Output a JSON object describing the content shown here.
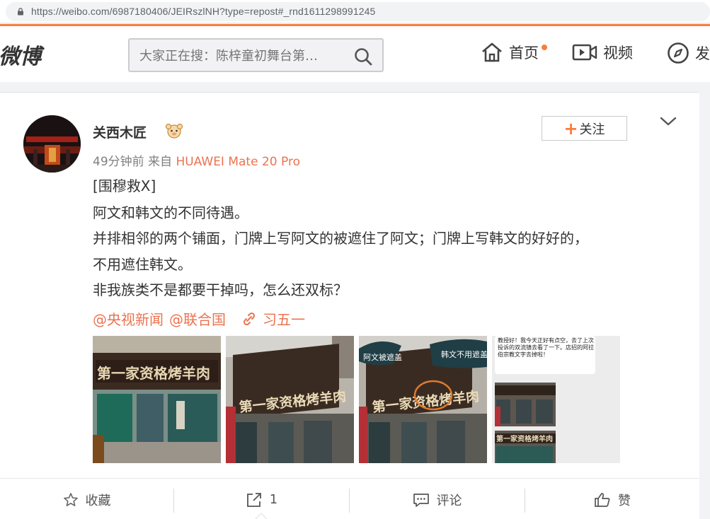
{
  "browser": {
    "url": "https://weibo.com/6987180406/JEIRszlNH?type=repost#_rnd1611298991245"
  },
  "nav": {
    "logo": "微博",
    "search_placeholder": "大家正在搜：陈梓童初舞台第…",
    "items": [
      {
        "label": "首页",
        "icon": "home-icon"
      },
      {
        "label": "视频",
        "icon": "video-icon"
      },
      {
        "label": "发",
        "icon": "compass-icon"
      }
    ]
  },
  "post": {
    "username": "关西木匠",
    "time": "49分钟前",
    "from_label": "来自",
    "device": "HUAWEI Mate 20 Pro",
    "follow_label": "关注",
    "lines": [
      "[围穆救X]",
      "阿文和韩文的不同待遇。",
      "并排相邻的两个铺面，门牌上写阿文的被遮住了阿文；门牌上写韩文的好好的，",
      "不用遮住韩文。",
      "非我族类不是都要干掉吗，怎么还双标？"
    ],
    "mentions": [
      "@央视新闻",
      "@联合国"
    ],
    "topic_link": "习五一",
    "images": [
      {
        "sign_text": "第一家资格烤羊肉",
        "small_text": ""
      },
      {
        "sign_text": "第一家资格烤羊肉",
        "small_text": ""
      },
      {
        "sign_text": "第一家资格烤羊肉",
        "bubble1": "阿文被遮盖",
        "bubble2": "韩文不用遮盖"
      },
      {
        "chat_text": "教授好！我今天正好有点空，去了上次投诉的双流镇去看了一下。店招的阿拉伯宗教文字去掉啦！",
        "sign_text": "第一家资格烤羊肉"
      }
    ]
  },
  "actions": {
    "favorite": "收藏",
    "repost": "1",
    "comment": "评论",
    "like": "赞"
  },
  "colors": {
    "accent": "#fa7d3c",
    "link": "#eb7350"
  }
}
